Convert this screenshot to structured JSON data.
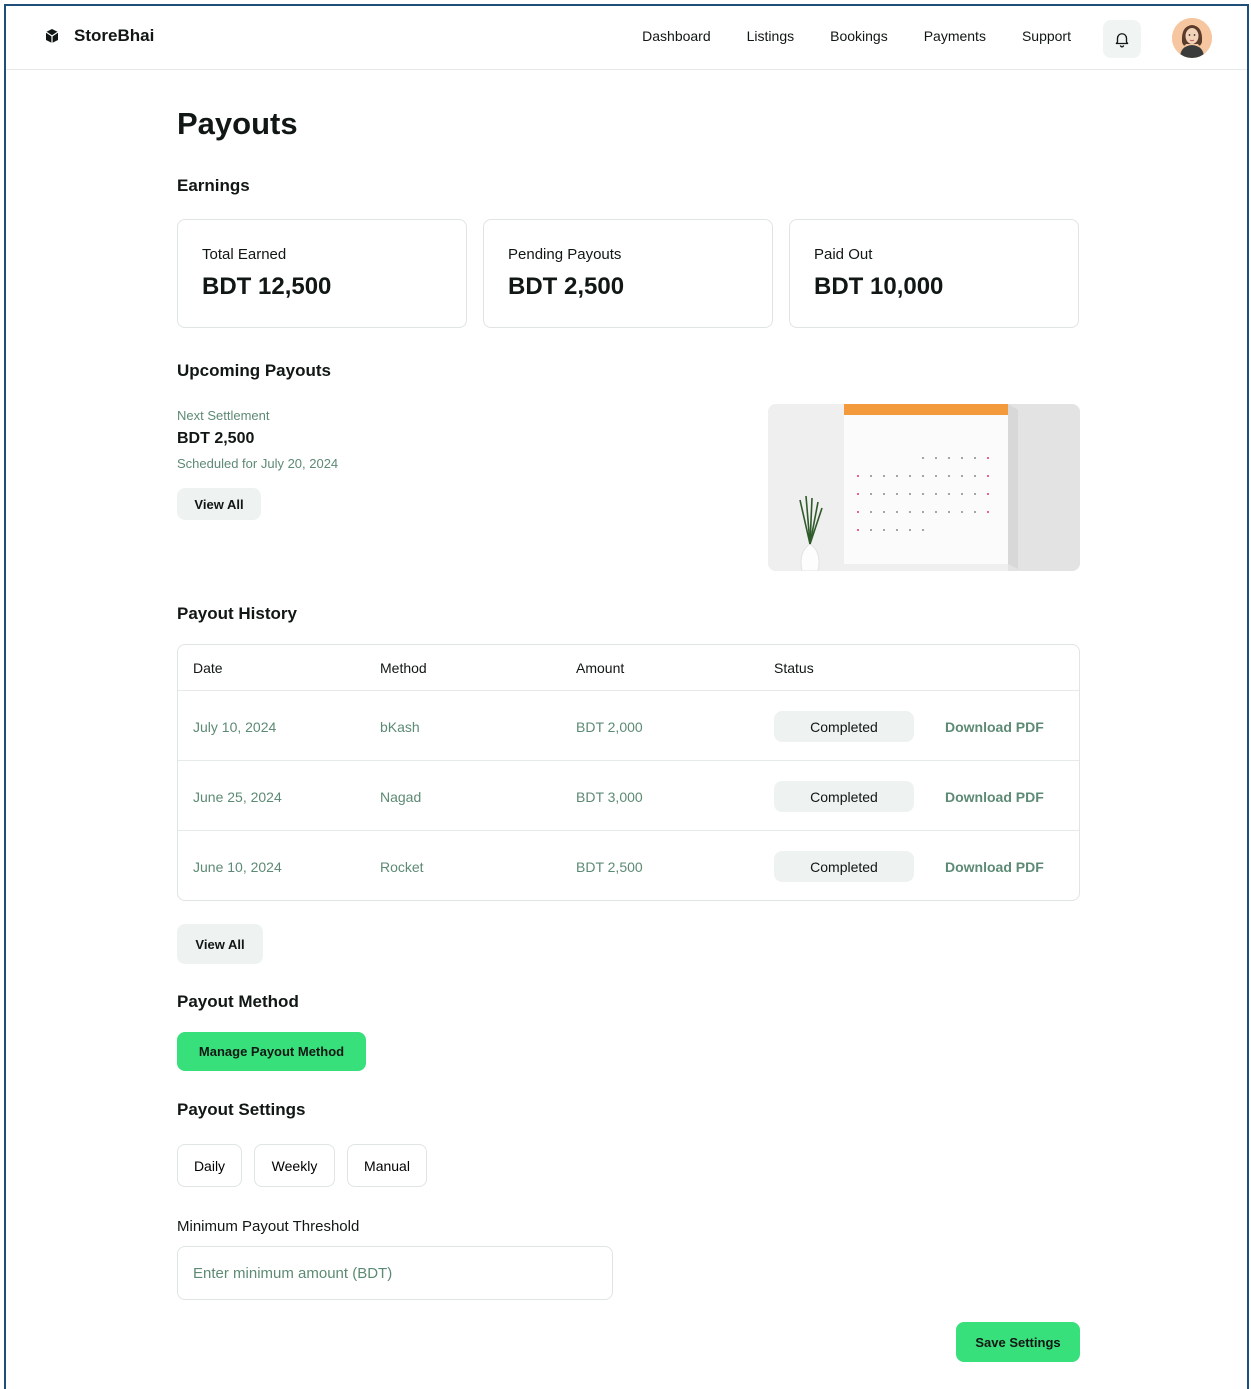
{
  "app": {
    "name": "StoreBhai"
  },
  "nav": [
    "Dashboard",
    "Listings",
    "Bookings",
    "Payments",
    "Support"
  ],
  "page_title": "Payouts",
  "earnings": {
    "title": "Earnings",
    "cards": [
      {
        "label": "Total Earned",
        "value": "BDT 12,500"
      },
      {
        "label": "Pending Payouts",
        "value": "BDT 2,500"
      },
      {
        "label": "Paid Out",
        "value": "BDT 10,000"
      }
    ]
  },
  "upcoming": {
    "title": "Upcoming Payouts",
    "next_label": "Next Settlement",
    "amount": "BDT 2,500",
    "scheduled": "Scheduled for July 20, 2024",
    "view_all": "View All"
  },
  "history": {
    "title": "Payout History",
    "columns": [
      "Date",
      "Method",
      "Amount",
      "Status"
    ],
    "rows": [
      {
        "date": "July 10, 2024",
        "method": "bKash",
        "amount": "BDT 2,000",
        "status": "Completed",
        "action": "Download PDF"
      },
      {
        "date": "June 25, 2024",
        "method": "Nagad",
        "amount": "BDT 3,000",
        "status": "Completed",
        "action": "Download PDF"
      },
      {
        "date": "June 10, 2024",
        "method": "Rocket",
        "amount": "BDT 2,500",
        "status": "Completed",
        "action": "Download PDF"
      }
    ],
    "view_all": "View All"
  },
  "method": {
    "title": "Payout Method",
    "button": "Manage Payout Method"
  },
  "settings": {
    "title": "Payout Settings",
    "frequencies": [
      "Daily",
      "Weekly",
      "Manual"
    ],
    "threshold_label": "Minimum Payout Threshold",
    "threshold_placeholder": "Enter minimum amount (BDT)",
    "save": "Save Settings"
  },
  "colors": {
    "accent": "#38e07b",
    "muted": "#5d8a74",
    "border": "#dfe5e2",
    "frame": "#1f4e79"
  }
}
